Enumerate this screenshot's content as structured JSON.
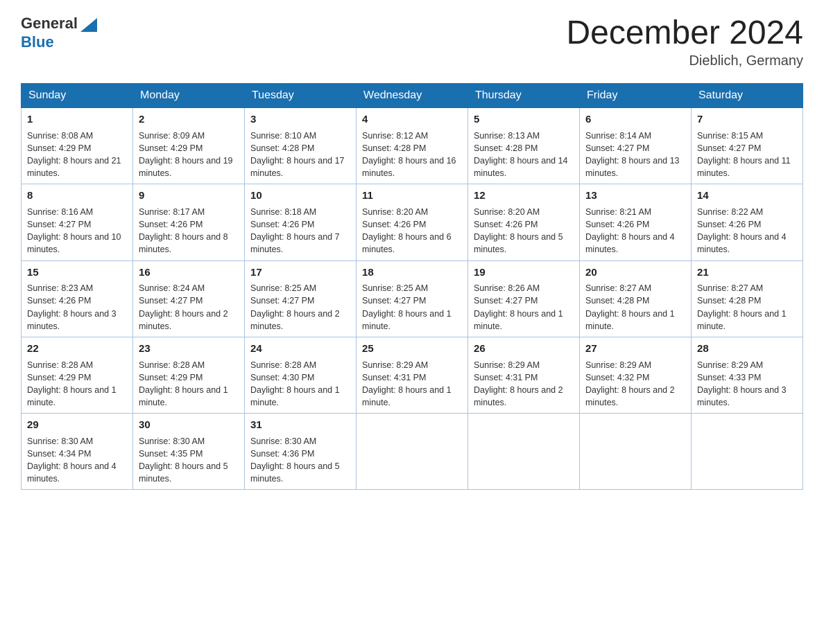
{
  "header": {
    "logo_general": "General",
    "logo_blue": "Blue",
    "month_year": "December 2024",
    "location": "Dieblich, Germany"
  },
  "days_of_week": [
    "Sunday",
    "Monday",
    "Tuesday",
    "Wednesday",
    "Thursday",
    "Friday",
    "Saturday"
  ],
  "weeks": [
    [
      {
        "day": "1",
        "sunrise": "8:08 AM",
        "sunset": "4:29 PM",
        "daylight": "8 hours and 21 minutes."
      },
      {
        "day": "2",
        "sunrise": "8:09 AM",
        "sunset": "4:29 PM",
        "daylight": "8 hours and 19 minutes."
      },
      {
        "day": "3",
        "sunrise": "8:10 AM",
        "sunset": "4:28 PM",
        "daylight": "8 hours and 17 minutes."
      },
      {
        "day": "4",
        "sunrise": "8:12 AM",
        "sunset": "4:28 PM",
        "daylight": "8 hours and 16 minutes."
      },
      {
        "day": "5",
        "sunrise": "8:13 AM",
        "sunset": "4:28 PM",
        "daylight": "8 hours and 14 minutes."
      },
      {
        "day": "6",
        "sunrise": "8:14 AM",
        "sunset": "4:27 PM",
        "daylight": "8 hours and 13 minutes."
      },
      {
        "day": "7",
        "sunrise": "8:15 AM",
        "sunset": "4:27 PM",
        "daylight": "8 hours and 11 minutes."
      }
    ],
    [
      {
        "day": "8",
        "sunrise": "8:16 AM",
        "sunset": "4:27 PM",
        "daylight": "8 hours and 10 minutes."
      },
      {
        "day": "9",
        "sunrise": "8:17 AM",
        "sunset": "4:26 PM",
        "daylight": "8 hours and 8 minutes."
      },
      {
        "day": "10",
        "sunrise": "8:18 AM",
        "sunset": "4:26 PM",
        "daylight": "8 hours and 7 minutes."
      },
      {
        "day": "11",
        "sunrise": "8:20 AM",
        "sunset": "4:26 PM",
        "daylight": "8 hours and 6 minutes."
      },
      {
        "day": "12",
        "sunrise": "8:20 AM",
        "sunset": "4:26 PM",
        "daylight": "8 hours and 5 minutes."
      },
      {
        "day": "13",
        "sunrise": "8:21 AM",
        "sunset": "4:26 PM",
        "daylight": "8 hours and 4 minutes."
      },
      {
        "day": "14",
        "sunrise": "8:22 AM",
        "sunset": "4:26 PM",
        "daylight": "8 hours and 4 minutes."
      }
    ],
    [
      {
        "day": "15",
        "sunrise": "8:23 AM",
        "sunset": "4:26 PM",
        "daylight": "8 hours and 3 minutes."
      },
      {
        "day": "16",
        "sunrise": "8:24 AM",
        "sunset": "4:27 PM",
        "daylight": "8 hours and 2 minutes."
      },
      {
        "day": "17",
        "sunrise": "8:25 AM",
        "sunset": "4:27 PM",
        "daylight": "8 hours and 2 minutes."
      },
      {
        "day": "18",
        "sunrise": "8:25 AM",
        "sunset": "4:27 PM",
        "daylight": "8 hours and 1 minute."
      },
      {
        "day": "19",
        "sunrise": "8:26 AM",
        "sunset": "4:27 PM",
        "daylight": "8 hours and 1 minute."
      },
      {
        "day": "20",
        "sunrise": "8:27 AM",
        "sunset": "4:28 PM",
        "daylight": "8 hours and 1 minute."
      },
      {
        "day": "21",
        "sunrise": "8:27 AM",
        "sunset": "4:28 PM",
        "daylight": "8 hours and 1 minute."
      }
    ],
    [
      {
        "day": "22",
        "sunrise": "8:28 AM",
        "sunset": "4:29 PM",
        "daylight": "8 hours and 1 minute."
      },
      {
        "day": "23",
        "sunrise": "8:28 AM",
        "sunset": "4:29 PM",
        "daylight": "8 hours and 1 minute."
      },
      {
        "day": "24",
        "sunrise": "8:28 AM",
        "sunset": "4:30 PM",
        "daylight": "8 hours and 1 minute."
      },
      {
        "day": "25",
        "sunrise": "8:29 AM",
        "sunset": "4:31 PM",
        "daylight": "8 hours and 1 minute."
      },
      {
        "day": "26",
        "sunrise": "8:29 AM",
        "sunset": "4:31 PM",
        "daylight": "8 hours and 2 minutes."
      },
      {
        "day": "27",
        "sunrise": "8:29 AM",
        "sunset": "4:32 PM",
        "daylight": "8 hours and 2 minutes."
      },
      {
        "day": "28",
        "sunrise": "8:29 AM",
        "sunset": "4:33 PM",
        "daylight": "8 hours and 3 minutes."
      }
    ],
    [
      {
        "day": "29",
        "sunrise": "8:30 AM",
        "sunset": "4:34 PM",
        "daylight": "8 hours and 4 minutes."
      },
      {
        "day": "30",
        "sunrise": "8:30 AM",
        "sunset": "4:35 PM",
        "daylight": "8 hours and 5 minutes."
      },
      {
        "day": "31",
        "sunrise": "8:30 AM",
        "sunset": "4:36 PM",
        "daylight": "8 hours and 5 minutes."
      },
      null,
      null,
      null,
      null
    ]
  ]
}
